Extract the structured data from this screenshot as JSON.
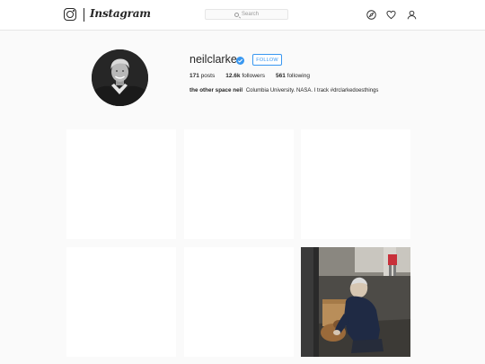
{
  "header": {
    "wordmark": "Instagram",
    "search_placeholder": "Search",
    "icons": [
      "instagram-logo-icon",
      "explore-compass-icon",
      "activity-heart-icon",
      "profile-person-icon"
    ]
  },
  "profile": {
    "username": "neilclarke",
    "verified": true,
    "follow_label": "FOLLOW",
    "stats": [
      {
        "value": "171",
        "label": "posts"
      },
      {
        "value": "12.6k",
        "label": "followers"
      },
      {
        "value": "561",
        "label": "following"
      }
    ],
    "bio_name": "the other space neil",
    "bio_text": "Columbia University. NASA. I track #drclarkedoesthings"
  },
  "colors": {
    "accent": "#3897f0",
    "text": "#262626",
    "background": "#fafafa"
  }
}
